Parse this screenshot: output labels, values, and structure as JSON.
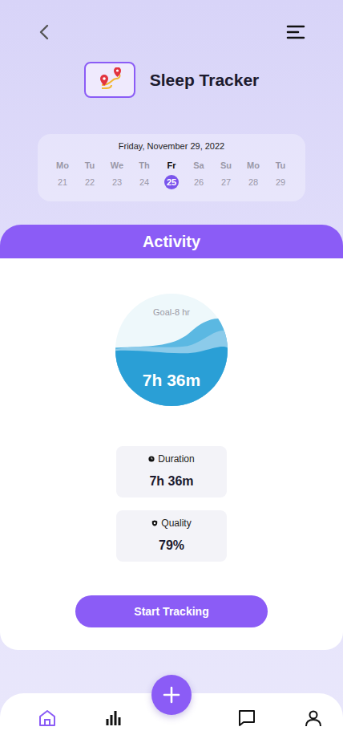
{
  "header": {
    "title": "Sleep Tracker"
  },
  "calendar": {
    "date": "Friday, November 29, 2022",
    "days": [
      {
        "weekday": "Mo",
        "day": "21",
        "selected": false
      },
      {
        "weekday": "Tu",
        "day": "22",
        "selected": false
      },
      {
        "weekday": "We",
        "day": "23",
        "selected": false
      },
      {
        "weekday": "Th",
        "day": "24",
        "selected": false
      },
      {
        "weekday": "Fr",
        "day": "25",
        "selected": true
      },
      {
        "weekday": "Sa",
        "day": "26",
        "selected": false
      },
      {
        "weekday": "Su",
        "day": "27",
        "selected": false
      },
      {
        "weekday": "Mo",
        "day": "28",
        "selected": false
      },
      {
        "weekday": "Tu",
        "day": "29",
        "selected": false
      }
    ]
  },
  "activity": {
    "title": "Activity",
    "goal": "Goal-8 hr",
    "total": "7h 36m",
    "level": 0.52,
    "stats": [
      {
        "label": "Duration",
        "value": "7h 36m",
        "kind": "duration"
      },
      {
        "label": "Quality",
        "value": "79%",
        "kind": "quality"
      }
    ],
    "button": "Start Tracking"
  },
  "nav": [
    {
      "kind": "home",
      "selected": true
    },
    {
      "kind": "stats",
      "selected": false
    },
    {
      "kind": "messages",
      "selected": false
    },
    {
      "kind": "profile",
      "selected": false
    }
  ]
}
